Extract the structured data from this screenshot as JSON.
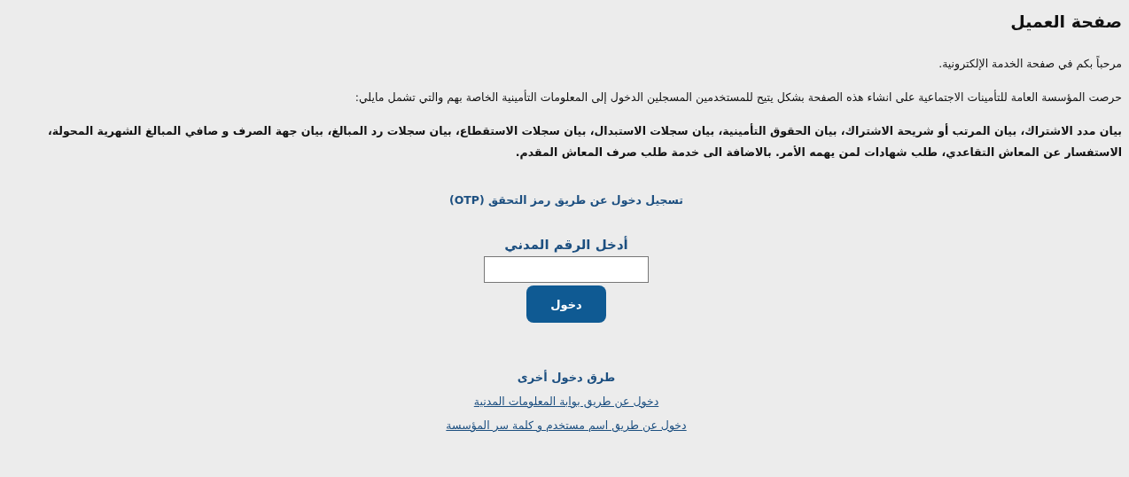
{
  "page_title": "صفحة العميل",
  "welcome": "مرحباً بكم في صفحة الخدمة الإلكترونية.",
  "intro": "حرصت المؤسسة العامة للتأمينات الاجتماعية على انشاء هذه الصفحة بشكل يتيح للمستخدمين المسجلين الدخول إلى المعلومات التأمينية الخاصة بهم والتي تشمل مايلي:",
  "services": "بيان مدد الاشتراك، بيان المرتب أو شريحة الاشتراك، بيان الحقوق التأمينية، بيان سجلات الاستبدال، بيان سجلات الاستقطاع، بيان سجلات رد المبالغ، بيان جهة الصرف و صافي المبالغ الشهرية المحولة، الاستفسار عن المعاش التقاعدي، طلب شهادات لمن يهمه الأمر. بالاضافة الى خدمة طلب صرف المعاش المقدم.",
  "otp_heading": "تسجيل دخول عن طريق رمز التحقق (OTP)",
  "civil_id_label": "أدخل الرقم المدني",
  "login_button": "دخول",
  "other_methods_heading": "طرق دخول أخرى",
  "other_methods": [
    "دخول عن طريق بوابة المعلومات المدنية",
    "دخول عن طريق اسم مستخدم و كلمة سر المؤسسة"
  ]
}
